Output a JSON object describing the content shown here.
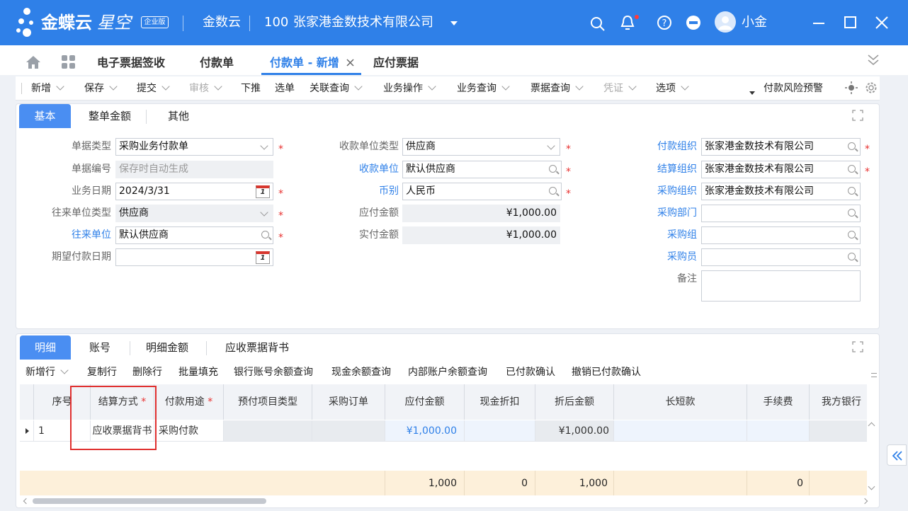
{
  "app": {
    "brand": "金蝶云",
    "product": "星空",
    "edition": "企业版",
    "cloud": "金数云",
    "org_code": "100",
    "org_name": "张家港金数技术有限公司",
    "user": "小金"
  },
  "tabs": [
    {
      "label": "电子票据签收"
    },
    {
      "label": "付款单"
    },
    {
      "label": "付款单 - 新增"
    },
    {
      "label": "应付票据"
    }
  ],
  "toolbar": {
    "items": [
      "新增",
      "保存",
      "提交",
      "审核",
      "下推",
      "选单",
      "关联查询",
      "业务操作",
      "业务查询",
      "票据查询",
      "凭证",
      "选项"
    ],
    "risk": "付款风险预警"
  },
  "header_tabs": [
    "基本",
    "整单金额",
    "其他"
  ],
  "form": {
    "bill_type_label": "单据类型",
    "bill_type": "采购业务付款单",
    "bill_no_label": "单据编号",
    "bill_no_placeholder": "保存时自动生成",
    "date_label": "业务日期",
    "date": "2024/3/31",
    "contact_type_label": "往来单位类型",
    "contact_type": "供应商",
    "contact_label": "往来单位",
    "contact": "默认供应商",
    "expected_date_label": "期望付款日期",
    "payee_type_label": "收款单位类型",
    "payee_type": "供应商",
    "payee_label": "收款单位",
    "payee": "默认供应商",
    "currency_label": "币别",
    "currency": "人民币",
    "payable_label": "应付金额",
    "payable": "¥1,000.00",
    "paid_label": "实付金额",
    "paid": "¥1,000.00",
    "pay_org_label": "付款组织",
    "pay_org": "张家港金数技术有限公司",
    "settle_org_label": "结算组织",
    "settle_org": "张家港金数技术有限公司",
    "purchase_org_label": "采购组织",
    "purchase_org": "张家港金数技术有限公司",
    "purchase_dept_label": "采购部门",
    "purchase_group_label": "采购组",
    "purchaser_label": "采购员",
    "remark_label": "备注",
    "calendar_day": "1"
  },
  "detail_tabs": [
    "明细",
    "账号",
    "明细金额",
    "应收票据背书"
  ],
  "entry_toolbar": [
    "新增行",
    "复制行",
    "删除行",
    "批量填充",
    "银行账号余额查询",
    "现金余额查询",
    "内部账户余额查询",
    "已付款确认",
    "撤销已付款确认"
  ],
  "grid": {
    "columns": [
      "序号",
      "结算方式",
      "付款用途",
      "预付项目类型",
      "采购订单",
      "应付金额",
      "现金折扣",
      "折后金额",
      "长短款",
      "手续费",
      "我方银行"
    ],
    "row": {
      "seq": "1",
      "settle_method": "应收票据背书",
      "purpose": "采购付款",
      "payable": "¥1,000.00",
      "after_discount": "¥1,000.00"
    },
    "totals": {
      "payable": "1,000",
      "discount": "0",
      "after_discount": "1,000",
      "fee": "0"
    }
  },
  "colors": {
    "brand": "#2f80e8",
    "active_tab": "#4a8ef2",
    "required": "#e8302f",
    "highlight": "#e0302f"
  }
}
